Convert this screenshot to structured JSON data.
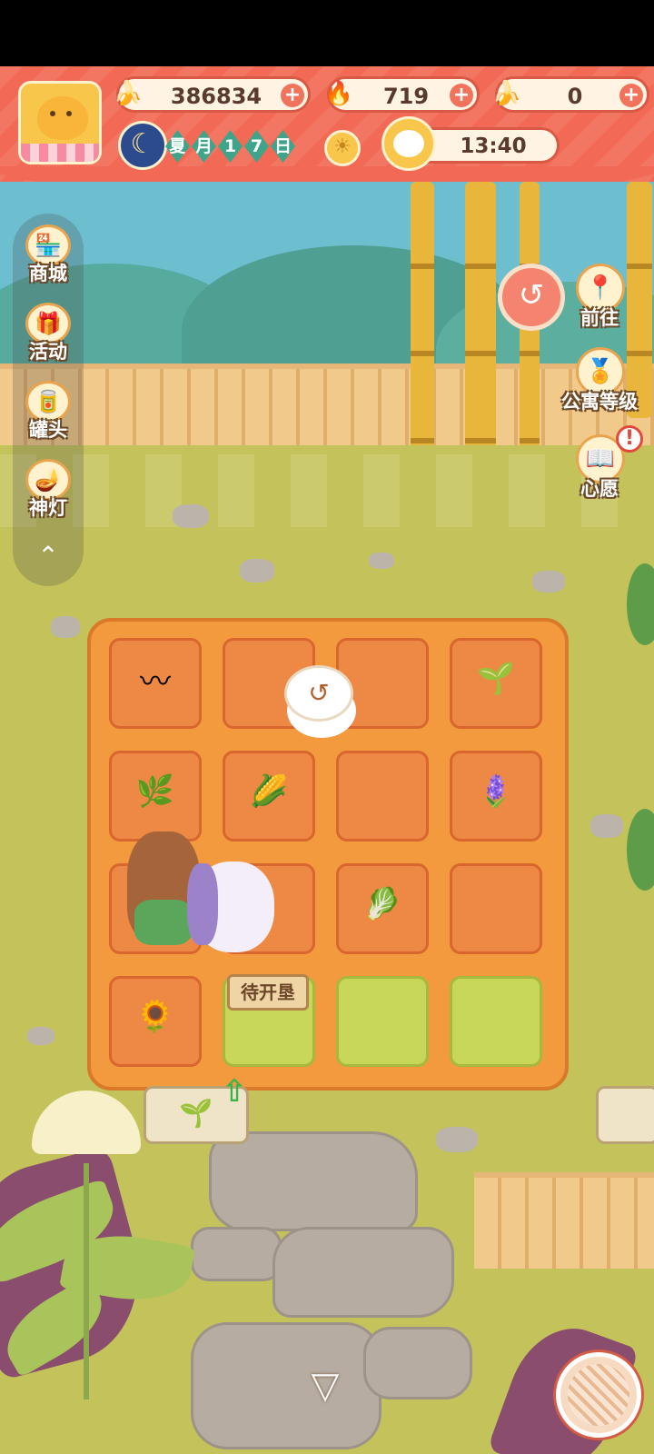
{
  "resources": {
    "bananas": {
      "icon": "banana-icon",
      "value": "386834"
    },
    "flames": {
      "icon": "blue-flame-icon",
      "value": "719"
    },
    "blue_bananas": {
      "icon": "blue-banana-icon",
      "value": "0"
    }
  },
  "calendar": {
    "chars": [
      "夏",
      "月",
      "1",
      "7",
      "日"
    ],
    "weather_icon": "sun-icon"
  },
  "clock": {
    "time": "13:40"
  },
  "side_menu": [
    {
      "id": "shop",
      "label": "商城",
      "icon": "shop-icon",
      "glyph": "🏪"
    },
    {
      "id": "event",
      "label": "活动",
      "icon": "gift-icon",
      "glyph": "🎁"
    },
    {
      "id": "can",
      "label": "罐头",
      "icon": "can-icon",
      "glyph": "🥫"
    },
    {
      "id": "lamp",
      "label": "神灯",
      "icon": "magic-lamp-icon",
      "glyph": "🪔"
    }
  ],
  "right_menu": [
    {
      "id": "goto",
      "label": "前往",
      "icon": "map-pin-icon",
      "glyph": "📍"
    },
    {
      "id": "apartment",
      "label": "公寓等级",
      "icon": "apartment-level-icon",
      "glyph": "🏅"
    },
    {
      "id": "wish",
      "label": "心愿",
      "icon": "wish-book-icon",
      "glyph": "📖",
      "alert": "!"
    }
  ],
  "farm": {
    "sign_label": "待开垦",
    "plots": [
      {
        "state": "soil",
        "plant": "seed",
        "glyph": "〰"
      },
      {
        "state": "soil",
        "plant": "",
        "glyph": ""
      },
      {
        "state": "soil",
        "plant": "",
        "glyph": ""
      },
      {
        "state": "soil",
        "plant": "sprout",
        "glyph": "🌱"
      },
      {
        "state": "soil",
        "plant": "seedling",
        "glyph": "🌿"
      },
      {
        "state": "soil",
        "plant": "corn",
        "glyph": "🌽"
      },
      {
        "state": "soil",
        "plant": "",
        "glyph": ""
      },
      {
        "state": "soil",
        "plant": "lavender",
        "glyph": "🪻"
      },
      {
        "state": "soil",
        "plant": "",
        "glyph": ""
      },
      {
        "state": "soil",
        "plant": "",
        "glyph": ""
      },
      {
        "state": "soil",
        "plant": "cabbage",
        "glyph": "🥬"
      },
      {
        "state": "soil",
        "plant": "",
        "glyph": ""
      },
      {
        "state": "soil",
        "plant": "sunflower",
        "glyph": "🌻"
      },
      {
        "state": "grass",
        "plant": "",
        "glyph": ""
      },
      {
        "state": "grass",
        "plant": "",
        "glyph": ""
      },
      {
        "state": "grass",
        "plant": "",
        "glyph": ""
      }
    ]
  },
  "colors": {
    "header": "#f26a55",
    "farm_soil": "#ee8945",
    "grass": "#c4c35b",
    "sky": "#6dbfd0"
  }
}
